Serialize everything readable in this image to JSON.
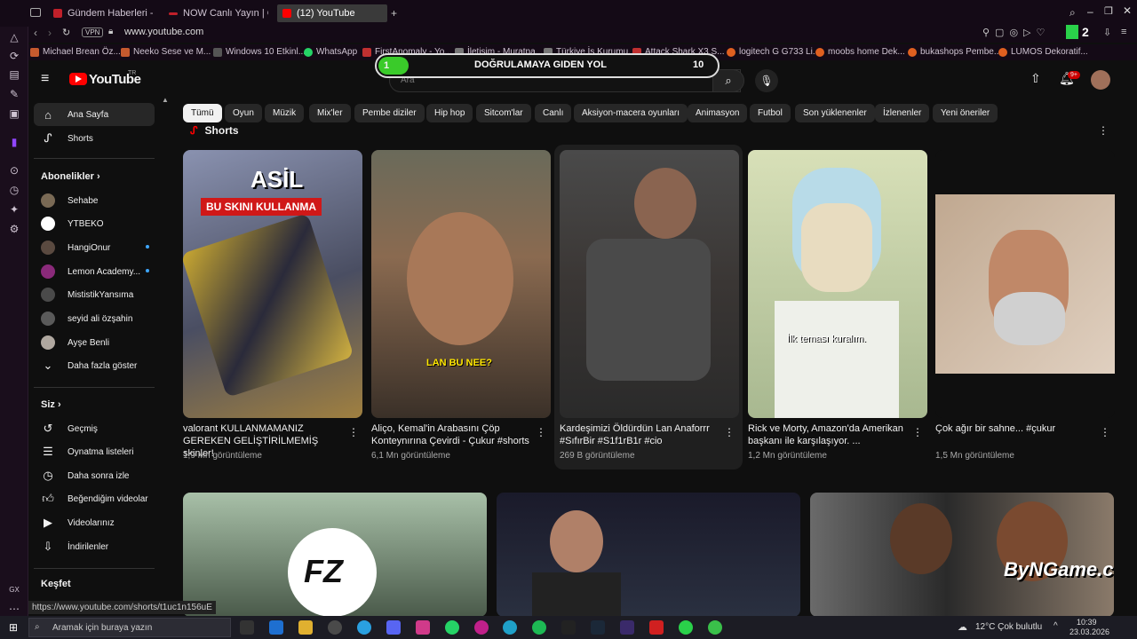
{
  "browser": {
    "tabs": [
      {
        "title": "Gündem Haberleri - En Gü",
        "color": "#c0202a"
      },
      {
        "title": "NOW Canlı Yayın | Canlı T",
        "color": "#c0202a"
      },
      {
        "title": "(12) YouTube",
        "color": "#ff0000"
      }
    ],
    "address": {
      "vpn": "VPN",
      "url": "www.youtube.com"
    },
    "bookmarks": [
      "Michael Brean Öz...",
      "Neeko Sese ve M...",
      "Windows 10 Etkinl...",
      "WhatsApp",
      "FirstAnomaly - Yo...",
      "İletişim - Muratpa...",
      "Türkiye İş Kurumu...",
      "Attack Shark X3 S...",
      "logitech G G733 Li...",
      "moobs home Dek...",
      "bukashops Pembe...",
      "LUMOS Dekoratif..."
    ]
  },
  "overlay_banner": {
    "left_score": "1",
    "title": "DOĞRULAMAYA GIDEN YOL",
    "right_score": "10"
  },
  "header": {
    "logo_text": "YouTube",
    "logo_region": "TR",
    "search_placeholder": "Ara",
    "notification_count": "9+"
  },
  "sidebar": {
    "main": [
      {
        "label": "Ana Sayfa",
        "icon": "home-icon"
      },
      {
        "label": "Shorts",
        "icon": "shorts-icon"
      }
    ],
    "subscriptions_title": "Abonelikler",
    "subscriptions": [
      {
        "label": "Sehabe",
        "color": "#7a6a55",
        "live": false
      },
      {
        "label": "YTBEKO",
        "color": "#ffffff",
        "live": false
      },
      {
        "label": "HangiOnur",
        "color": "#5a4a40",
        "live": true
      },
      {
        "label": "Lemon Academy...",
        "color": "#8a2a7a",
        "live": true
      },
      {
        "label": "MististikYansıma",
        "color": "#4a4a4a",
        "live": false
      },
      {
        "label": "seyid ali özşahin",
        "color": "#5a5a5a",
        "live": false
      },
      {
        "label": "Ayşe Benli",
        "color": "#b0a8a0",
        "live": false
      }
    ],
    "show_more": "Daha fazla göster",
    "you_title": "Siz",
    "you_items": [
      {
        "label": "Geçmiş",
        "icon": "history-icon"
      },
      {
        "label": "Oynatma listeleri",
        "icon": "playlist-icon"
      },
      {
        "label": "Daha sonra izle",
        "icon": "clock-icon"
      },
      {
        "label": "Beğendiğim videolar",
        "icon": "like-icon"
      },
      {
        "label": "Videolarınız",
        "icon": "video-icon"
      },
      {
        "label": "İndirilenler",
        "icon": "download-icon"
      }
    ],
    "explore_title": "Keşfet"
  },
  "chips": [
    "Tümü",
    "Oyun",
    "Müzik",
    "Mix'ler",
    "Pembe diziler",
    "Hip hop",
    "Sitcom'lar",
    "Canlı",
    "Aksiyon-macera oyunları",
    "Animasyon",
    "Futbol",
    "Son yüklenenler",
    "İzlenenler",
    "Yeni öneriler"
  ],
  "shorts_heading": "Shorts",
  "shorts": [
    {
      "title": "valorant KULLANMAMANIZ GEREKEN  GELİŞTİRİLMEMİŞ skinler!",
      "views": "1,9 Mn görüntüleme",
      "bg": "#6a6e8a",
      "overlay_text": "ASİL",
      "overlay_sub": "BU SKINI KULLANMA"
    },
    {
      "title": "Aliço, Kemal'in Arabasını Çöp Konteynırına Çevirdi - Çukur #shorts",
      "views": "6,1 Mn görüntüleme",
      "bg": "#5a5040",
      "overlay_text": "LAN BU NEE?",
      "overlay_sub": ""
    },
    {
      "title": "Kardeşimizi Öldürdün Lan Anaforrr #SıfırBir #S1f1rB1r #cio",
      "views": "269 B görüntüleme",
      "bg": "#3a3a3a",
      "overlay_text": "",
      "overlay_sub": ""
    },
    {
      "title": "Rick ve Morty, Amazon'da Amerikan başkanı ile karşılaşıyor. ...",
      "views": "1,2 Mn görüntüleme",
      "bg": "#a8b890",
      "overlay_text": "İlk teması kuralım.",
      "overlay_sub": ""
    },
    {
      "title": "Çok ağır bir sahne... #çukur",
      "views": "1,5 Mn görüntüleme",
      "bg": "#c0a890",
      "overlay_text": "",
      "overlay_sub": ""
    }
  ],
  "videos": [
    {
      "bg": "#6a7a6a",
      "overlay_text": "FZ"
    },
    {
      "bg": "#2a2a3a",
      "overlay_text": ""
    },
    {
      "bg": "#4a4a4a",
      "overlay_text": "ByNGame.com"
    }
  ],
  "status_url": "https://www.youtube.com/shorts/t1uc1n156uE",
  "taskbar": {
    "search_placeholder": "Aramak için buraya yazın",
    "weather": "12°C  Çok bulutlu",
    "time": "10:39",
    "date": "23.03.2026"
  }
}
